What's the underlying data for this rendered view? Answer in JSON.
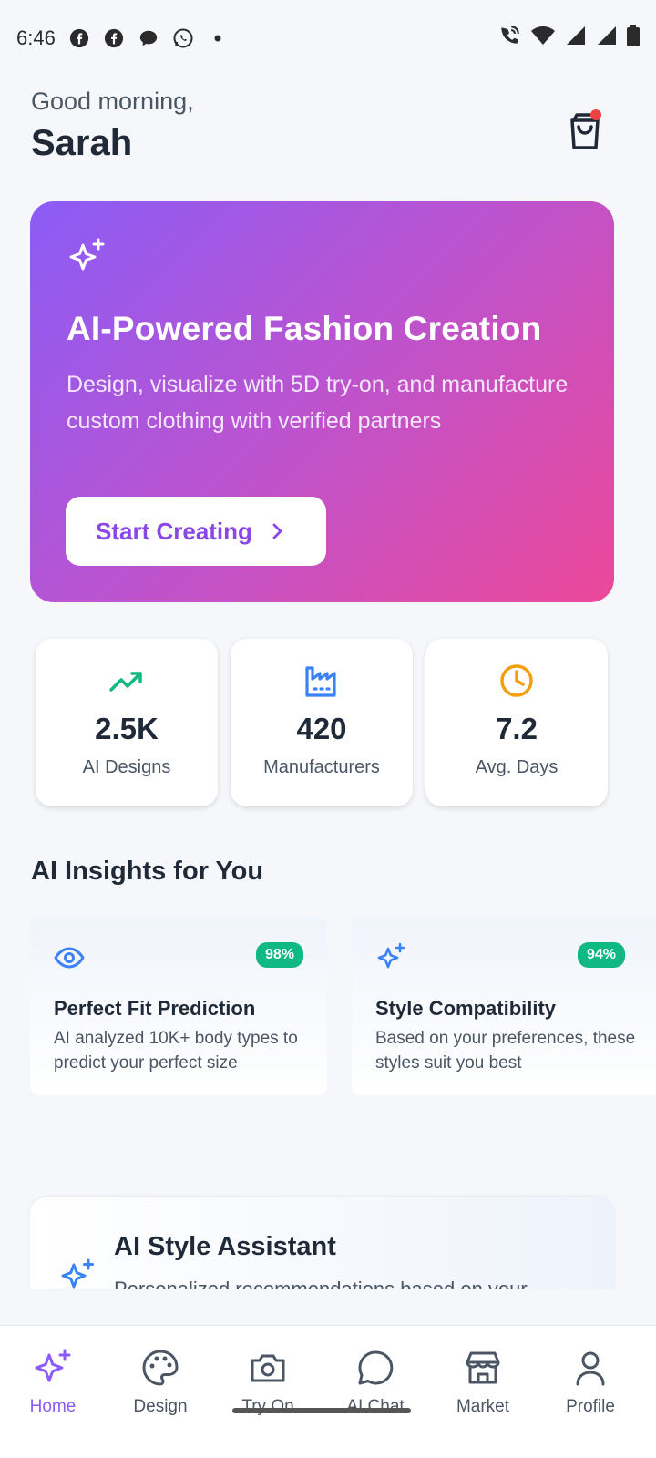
{
  "status_bar": {
    "time": "6:46",
    "notification_icons": [
      "facebook-icon",
      "facebook-icon",
      "chat-bubble-icon",
      "whatsapp-icon",
      "dot-icon"
    ],
    "system_icons": [
      "wifi-call-icon",
      "wifi-icon",
      "signal-icon",
      "signal-icon",
      "battery-icon"
    ]
  },
  "header": {
    "greeting": "Good morning,",
    "user_name": "Sarah",
    "cart_icon": "shopping-bag-icon",
    "cart_has_notification": true
  },
  "hero": {
    "icon": "sparkles-icon",
    "title": "AI-Powered Fashion Creation",
    "description": "Design, visualize with 5D try-on, and manufacture custom clothing with verified partners",
    "button_label": "Start Creating",
    "colors": {
      "gradient_start": "#8b5cf6",
      "gradient_end": "#ec4899"
    }
  },
  "stats": [
    {
      "icon": "trending-up-icon",
      "value": "2.5K",
      "label": "AI Designs",
      "color": "#10b981"
    },
    {
      "icon": "factory-icon",
      "value": "420",
      "label": "Manufacturers",
      "color": "#3b82f6"
    },
    {
      "icon": "clock-icon",
      "value": "7.2",
      "label": "Avg. Days",
      "color": "#f59e0b"
    }
  ],
  "insights": {
    "section_title": "AI Insights for You",
    "cards": [
      {
        "icon": "eye-icon",
        "badge": "98%",
        "title": "Perfect Fit Prediction",
        "description": "AI analyzed 10K+ body types to predict your perfect size"
      },
      {
        "icon": "sparkles-icon",
        "badge": "94%",
        "title": "Style Compatibility",
        "description": "Based on your preferences, these styles suit you best"
      }
    ]
  },
  "assistant": {
    "icon": "sparkles-icon",
    "title": "AI Style Assistant",
    "description": "Personalized recommendations based on your"
  },
  "bottom_nav": {
    "active": "Home",
    "items": [
      {
        "label": "Home",
        "icon": "sparkles-icon"
      },
      {
        "label": "Design",
        "icon": "palette-icon"
      },
      {
        "label": "Try On",
        "icon": "camera-icon"
      },
      {
        "label": "AI Chat",
        "icon": "chat-icon"
      },
      {
        "label": "Market",
        "icon": "store-icon"
      },
      {
        "label": "Profile",
        "icon": "user-icon"
      }
    ]
  }
}
